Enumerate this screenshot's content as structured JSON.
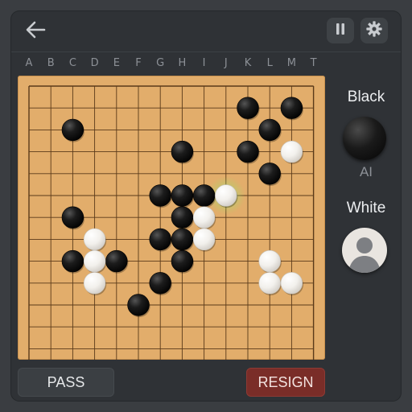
{
  "header": {
    "back_icon": "arrow-left-icon",
    "pause_icon": "pause-icon",
    "settings_icon": "gear-icon"
  },
  "board": {
    "size": 14,
    "column_labels": [
      "A",
      "B",
      "C",
      "D",
      "E",
      "F",
      "G",
      "H",
      "I",
      "J",
      "K",
      "L",
      "M",
      "T"
    ],
    "stones": {
      "black": [
        [
          10,
          1
        ],
        [
          12,
          1
        ],
        [
          2,
          2
        ],
        [
          11,
          2
        ],
        [
          7,
          3
        ],
        [
          10,
          3
        ],
        [
          11,
          4
        ],
        [
          6,
          5
        ],
        [
          7,
          5
        ],
        [
          8,
          5
        ],
        [
          2,
          6
        ],
        [
          7,
          6
        ],
        [
          6,
          7
        ],
        [
          7,
          7
        ],
        [
          2,
          8
        ],
        [
          4,
          8
        ],
        [
          7,
          8
        ],
        [
          6,
          9
        ],
        [
          5,
          10
        ]
      ],
      "white": [
        [
          12,
          3
        ],
        [
          9,
          5
        ],
        [
          8,
          6
        ],
        [
          3,
          7
        ],
        [
          8,
          7
        ],
        [
          3,
          8
        ],
        [
          11,
          8
        ],
        [
          3,
          9
        ],
        [
          11,
          9
        ],
        [
          12,
          9
        ]
      ]
    },
    "last_move": [
      9,
      5
    ],
    "colors": {
      "wood": "#e2ad6b",
      "grid": "#5a3a1a",
      "highlight": "#9be36a"
    }
  },
  "players": {
    "black": {
      "name": "Black",
      "type": "AI"
    },
    "white": {
      "name": "White",
      "avatar_icon": "user-avatar-icon"
    }
  },
  "actions": {
    "pass_label": "PASS",
    "resign_label": "RESIGN"
  }
}
